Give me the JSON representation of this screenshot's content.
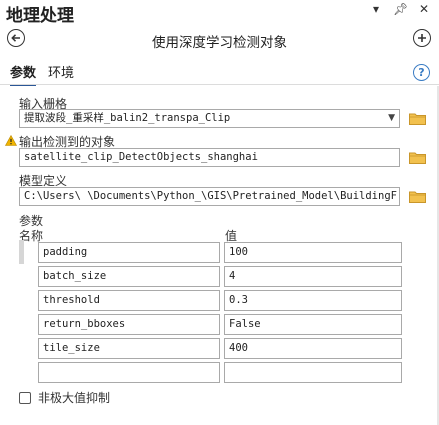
{
  "pane": {
    "title": "地理处理"
  },
  "tool": {
    "title": "使用深度学习检测对象"
  },
  "tabs": [
    {
      "label": "参数"
    },
    {
      "label": "环境"
    }
  ],
  "help": {
    "label": "?"
  },
  "input_raster": {
    "label": "输入栅格",
    "value": "提取波段_重采样_balin2_transpa_Clip"
  },
  "output_objects": {
    "label": "输出检测到的对象",
    "value": "satellite_clip_DetectObjects_shanghai"
  },
  "model_def": {
    "label": "模型定义",
    "value": "C:\\Users\\      \\Documents\\Python_\\GIS\\Pretrained_Model\\BuildingF"
  },
  "arguments": {
    "label": "参数",
    "col_name": "名称",
    "col_value": "值",
    "rows": [
      {
        "name": "padding",
        "value": "100"
      },
      {
        "name": "batch_size",
        "value": "4"
      },
      {
        "name": "threshold",
        "value": "0.3"
      },
      {
        "name": "return_bboxes",
        "value": "False"
      },
      {
        "name": "tile_size",
        "value": "400"
      },
      {
        "name": "",
        "value": ""
      }
    ]
  },
  "nms": {
    "label": "非极大值抑制",
    "checked": false
  },
  "icons": {
    "back": "back-arrow-icon",
    "add": "add-icon",
    "folder": "folder-icon",
    "warning": "warning-icon"
  }
}
